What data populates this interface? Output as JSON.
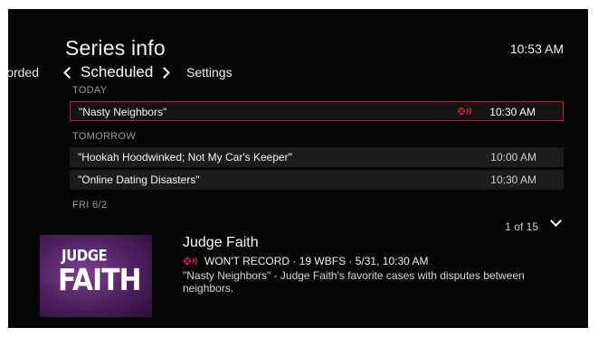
{
  "header": {
    "title": "Series info",
    "clock": "10:53 AM"
  },
  "tabs": {
    "previous": "Recorded",
    "current": "Scheduled",
    "next": "Settings"
  },
  "schedule": {
    "groups": [
      {
        "day": "TODAY",
        "items": [
          {
            "name": "\"Nasty Neighbors\"",
            "time": "10:30 AM",
            "selected": true,
            "status_icon": "wont-record-icon"
          }
        ]
      },
      {
        "day": "TOMORROW",
        "items": [
          {
            "name": "\"Hookah Hoodwinked; Not My Car's Keeper\"",
            "time": "10:00 AM"
          },
          {
            "name": "\"Online Dating Disasters\"",
            "time": "10:30 AM"
          }
        ]
      },
      {
        "day": "FRI 6/2",
        "items": []
      }
    ]
  },
  "pager": {
    "label": "1 of 15"
  },
  "details": {
    "poster_text_line1": "JUDGE",
    "poster_text_line2": "FAITH",
    "show_title": "Judge Faith",
    "meta": "WON'T RECORD · 19 WBFS · 5/31, 10:30 AM",
    "description": "\"Nasty Neighbors\" - Judge Faith's favorite cases with disputes between neighbors."
  },
  "colors": {
    "background": "#060606",
    "row_background": "#1c1c1c",
    "selection_border": "#c8193d",
    "record_icon": "#d8203a",
    "poster": "#5a2370"
  }
}
